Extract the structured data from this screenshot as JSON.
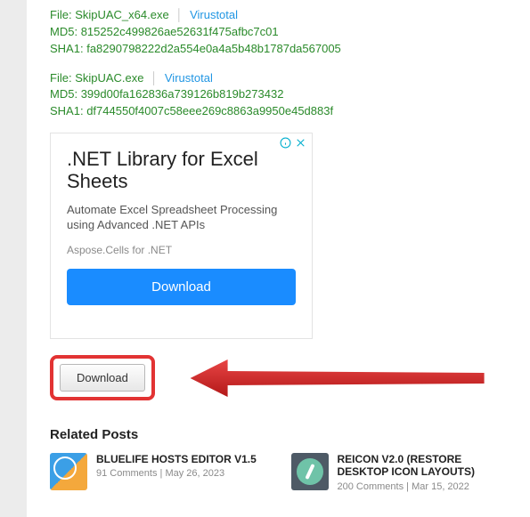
{
  "file1": {
    "file_label": "File:",
    "filename": "SkipUAC_x64.exe",
    "virustotal": "Virustotal",
    "md5_label": "MD5:",
    "md5": "815252c499826ae52631f475afbc7c01",
    "sha1_label": "SHA1:",
    "sha1": "fa8290798222d2a554e0a4a5b48b1787da567005"
  },
  "file2": {
    "file_label": "File:",
    "filename": "SkipUAC.exe",
    "virustotal": "Virustotal",
    "md5_label": "MD5:",
    "md5": "399d00fa162836a739126b819b273432",
    "sha1_label": "SHA1:",
    "sha1": "df744550f4007c58eee269c8863a9950e45d883f"
  },
  "ad": {
    "title": ".NET Library for Excel Sheets",
    "desc": "Automate Excel Spreadsheet Processing using Advanced .NET APIs",
    "brand": "Aspose.Cells for .NET",
    "button": "Download"
  },
  "download_button": "Download",
  "related_heading": "Related Posts",
  "posts": [
    {
      "title": "BLUELIFE HOSTS EDITOR V1.5",
      "comments": "91 Comments",
      "date": "May 26, 2023"
    },
    {
      "title": "REICON V2.0 (RESTORE DESKTOP ICON LAYOUTS)",
      "comments": "200 Comments",
      "date": "Mar 15, 2022"
    }
  ]
}
